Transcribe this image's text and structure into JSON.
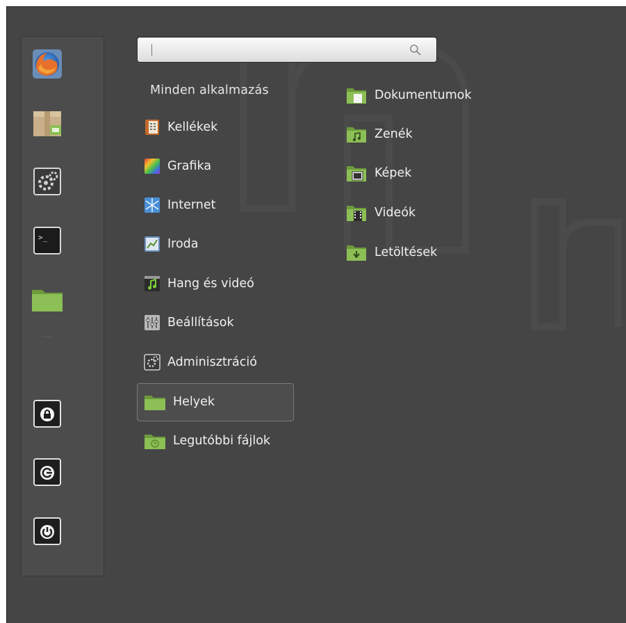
{
  "search": {
    "value": "",
    "placeholder": ""
  },
  "all_apps_label": "Minden alkalmazás",
  "favorites": [
    {
      "name": "firefox-icon"
    },
    {
      "name": "software-manager-icon"
    },
    {
      "name": "system-settings-icon"
    },
    {
      "name": "terminal-icon"
    },
    {
      "name": "home-folder-icon"
    }
  ],
  "session_buttons": [
    {
      "name": "lock-screen-icon"
    },
    {
      "name": "logout-icon"
    },
    {
      "name": "shutdown-icon"
    }
  ],
  "categories": [
    {
      "label": "Kellékek",
      "icon": "accessories-icon"
    },
    {
      "label": "Grafika",
      "icon": "graphics-icon"
    },
    {
      "label": "Internet",
      "icon": "internet-icon"
    },
    {
      "label": "Iroda",
      "icon": "office-icon"
    },
    {
      "label": "Hang és videó",
      "icon": "sound-video-icon"
    },
    {
      "label": "Beállítások",
      "icon": "preferences-icon"
    },
    {
      "label": "Adminisztráció",
      "icon": "administration-icon"
    },
    {
      "label": "Helyek",
      "icon": "places-folder-icon",
      "selected": true
    },
    {
      "label": "Legutóbbi fájlok",
      "icon": "recent-files-icon"
    }
  ],
  "places": [
    {
      "label": "Dokumentumok",
      "icon": "documents-folder-icon"
    },
    {
      "label": "Zenék",
      "icon": "music-folder-icon"
    },
    {
      "label": "Képek",
      "icon": "pictures-folder-icon"
    },
    {
      "label": "Videók",
      "icon": "videos-folder-icon"
    },
    {
      "label": "Letöltések",
      "icon": "downloads-folder-icon"
    }
  ],
  "colors": {
    "background": "#454545",
    "sidebar": "#4c4c4c",
    "folder_green": "#8cbf55",
    "text": "#f0f0f0"
  }
}
